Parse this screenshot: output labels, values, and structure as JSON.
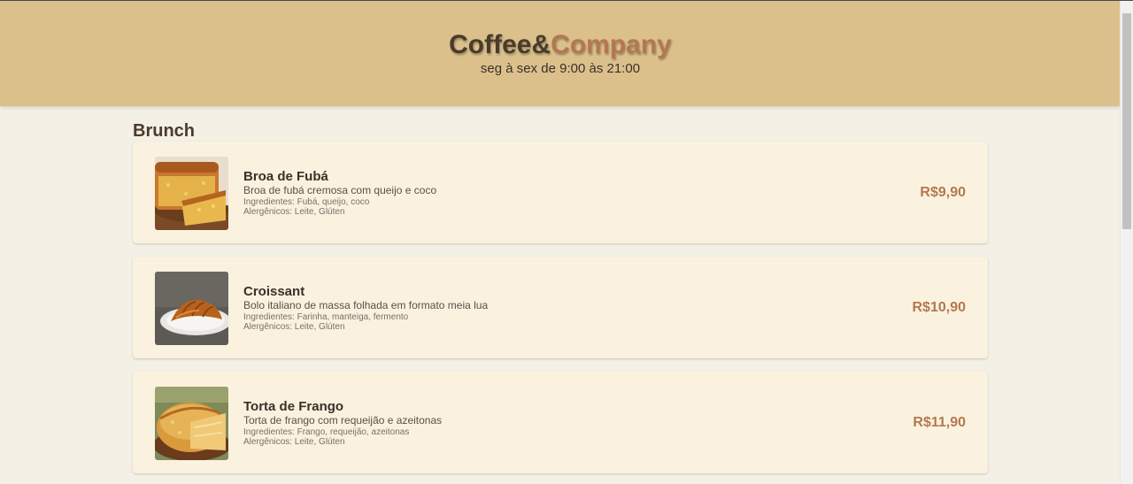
{
  "header": {
    "brand_part1": "Coffee&",
    "brand_part2": "Company",
    "hours": "seg à sex de 9:00 às 21:00"
  },
  "section": {
    "title": "Brunch"
  },
  "items": [
    {
      "name": "Broa de Fubá",
      "description": "Broa de fubá cremosa com queijo e coco",
      "ingredients": "Ingredientes: Fubá, queijo, coco",
      "allergens": "Alergênicos: Leite, Glúten",
      "price": "R$9,90",
      "image": "cornbread-cake-image"
    },
    {
      "name": "Croissant",
      "description": "Bolo italiano de massa folhada em formato meia lua",
      "ingredients": "Ingredientes: Farinha, manteiga, fermento",
      "allergens": "Alergênicos: Leite, Glúten",
      "price": "R$10,90",
      "image": "croissant-image"
    },
    {
      "name": "Torta de Frango",
      "description": "Torta de frango com requeijão e azeitonas",
      "ingredients": "Ingredientes: Frango, requeijão, azeitonas",
      "allergens": "Alergênicos: Leite, Glúten",
      "price": "R$11,90",
      "image": "chicken-pie-image"
    }
  ],
  "colors": {
    "header_bg": "#dbc08c",
    "page_bg": "#f4f0e6",
    "card_bg": "#faf2df",
    "accent": "#b47850",
    "text_dark": "#4a3b2c"
  }
}
